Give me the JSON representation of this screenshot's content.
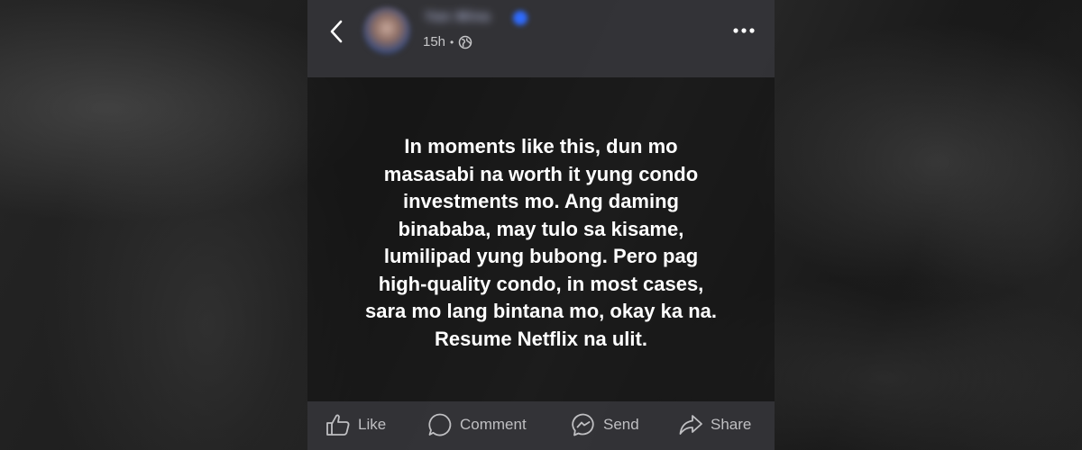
{
  "header": {
    "back_icon": "chevron-left-icon",
    "author_name": "Yan Mina",
    "verified_icon": "verified-badge-icon",
    "time": "15h",
    "separator": "•",
    "audience_icon": "globe-icon",
    "more_icon": "more-horizontal-icon"
  },
  "post": {
    "text": "In moments like this, dun mo\nmasasabi na worth it yung condo\ninvestments mo. Ang daming\nbinababa, may tulo sa kisame,\nlumilipad yung bubong. Pero pag\nhigh-quality condo, in most cases,\nsara mo lang bintana mo, okay ka na.\nResume Netflix na ulit."
  },
  "actions": {
    "like": {
      "label": "Like",
      "icon": "thumbs-up-icon"
    },
    "comment": {
      "label": "Comment",
      "icon": "comment-bubble-icon"
    },
    "send": {
      "label": "Send",
      "icon": "messenger-icon"
    },
    "share": {
      "label": "Share",
      "icon": "share-arrow-icon"
    }
  },
  "colors": {
    "text_primary": "#ffffff",
    "text_secondary": "#c6c6c8",
    "bar_background": "#343438",
    "verified": "#2f6bff"
  }
}
